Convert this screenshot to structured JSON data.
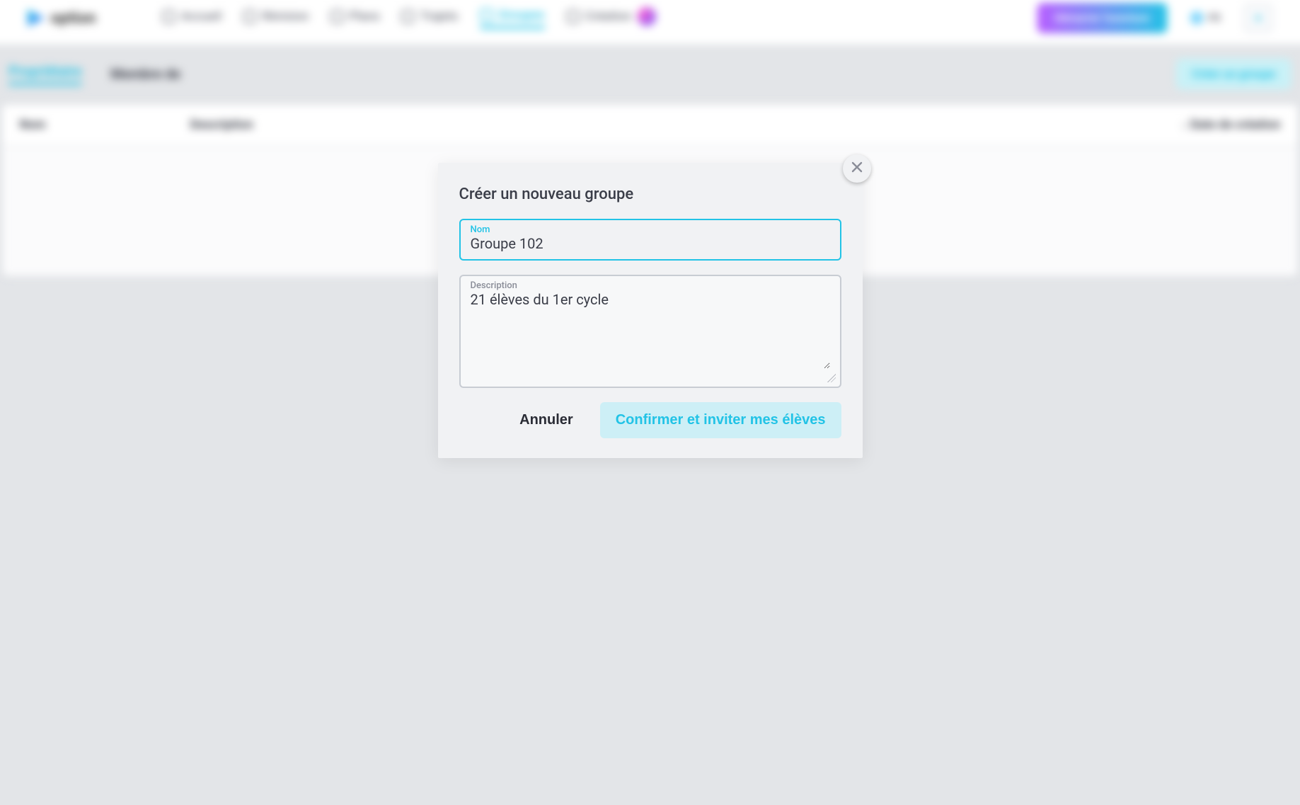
{
  "app": {
    "name": "option"
  },
  "nav": {
    "items": [
      {
        "label": "Accueil"
      },
      {
        "label": "Révision"
      },
      {
        "label": "Plans"
      },
      {
        "label": "Trajets"
      },
      {
        "label": "Groupes"
      },
      {
        "label": "Création"
      }
    ],
    "active_index": 4,
    "cta_label": "Démarrer l'aventure",
    "lang_label": "FR"
  },
  "subtabs": {
    "items": [
      {
        "label": "Propriétaire"
      },
      {
        "label": "Membre de"
      }
    ],
    "active_index": 0,
    "create_label": "Créer un groupe"
  },
  "table": {
    "columns": {
      "c1": "Nom",
      "c2": "Description",
      "c3": "↓ Date de création"
    }
  },
  "modal": {
    "title": "Créer un nouveau groupe",
    "name_label": "Nom",
    "name_value": "Groupe 102",
    "desc_label": "Description",
    "desc_value": "21 élèves du 1er cycle",
    "cancel_label": "Annuler",
    "confirm_label": "Confirmer et inviter mes élèves"
  }
}
